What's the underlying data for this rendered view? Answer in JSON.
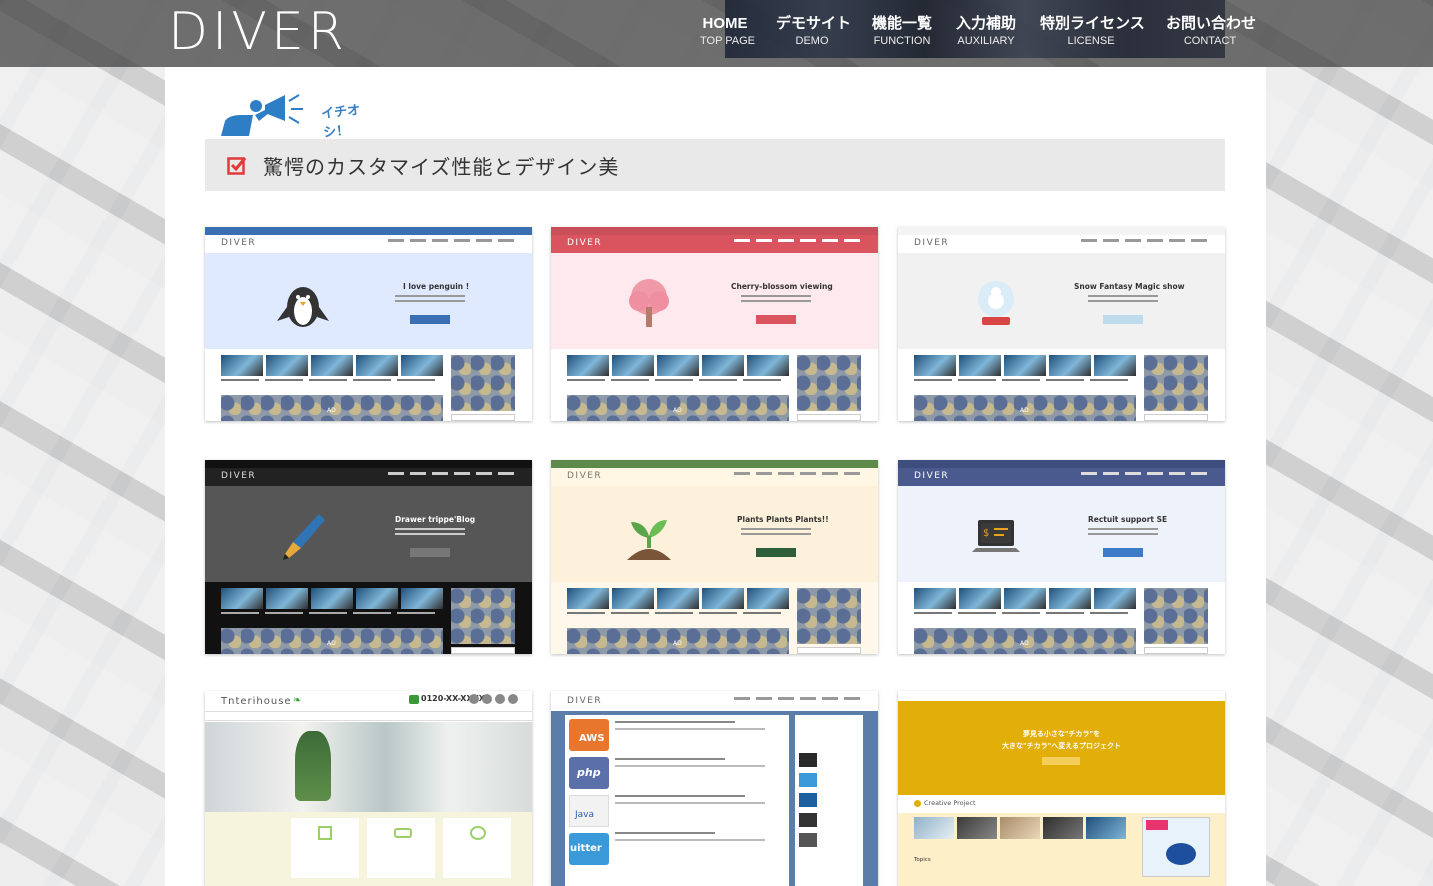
{
  "header": {
    "logo": "DIVER",
    "nav": [
      {
        "label": "HOME",
        "sub": "TOP PAGE"
      },
      {
        "label": "デモサイト",
        "sub": "DEMO"
      },
      {
        "label": "機能一覧",
        "sub": "FUNCTION"
      },
      {
        "label": "入力補助",
        "sub": "AUXILIARY"
      },
      {
        "label": "特別ライセンス",
        "sub": "LICENSE"
      },
      {
        "label": "お問い合わせ",
        "sub": "CONTACT"
      }
    ]
  },
  "pickup": {
    "label": "イチオシ！"
  },
  "section": {
    "title": "驚愕のカスタマイズ性能とデザイン美"
  },
  "cards": [
    {
      "logo": "DIVER",
      "hero_title": "I love penguin !",
      "ad": "AD",
      "theme": "penguin"
    },
    {
      "logo": "DIVER",
      "hero_title": "Cherry-blossom viewing",
      "ad": "AD",
      "theme": "cherry"
    },
    {
      "logo": "DIVER",
      "hero_title": "Snow Fantasy Magic show",
      "ad": "AD",
      "theme": "snow"
    },
    {
      "logo": "DIVER",
      "hero_title": "Drawer trippe'Blog",
      "ad": "AD",
      "theme": "drawer"
    },
    {
      "logo": "DIVER",
      "hero_title": "Plants Plants Plants!!",
      "ad": "AD",
      "theme": "plants"
    },
    {
      "logo": "DIVER",
      "hero_title": "Rectuit support SE",
      "ad": "AD",
      "theme": "recruit"
    },
    {
      "logo": "Tnterihouse",
      "phone": "0120-XX-XXXX",
      "theme": "interior"
    },
    {
      "logo": "DIVER",
      "tags": [
        "AWS",
        "php",
        "Java",
        "uitter"
      ],
      "theme": "tech"
    },
    {
      "heading_line1": "夢見る小さな\"チカラ\"を",
      "heading_line2": "大きな\"チカラ\"へ変えるプロジェクト",
      "project": "Creative Project",
      "topics": "Topics",
      "theme": "creative"
    }
  ],
  "colors": {
    "header_bg": "#3c3c3c",
    "check": "#e03a3a",
    "pickup_icon": "#2d7ec4"
  }
}
